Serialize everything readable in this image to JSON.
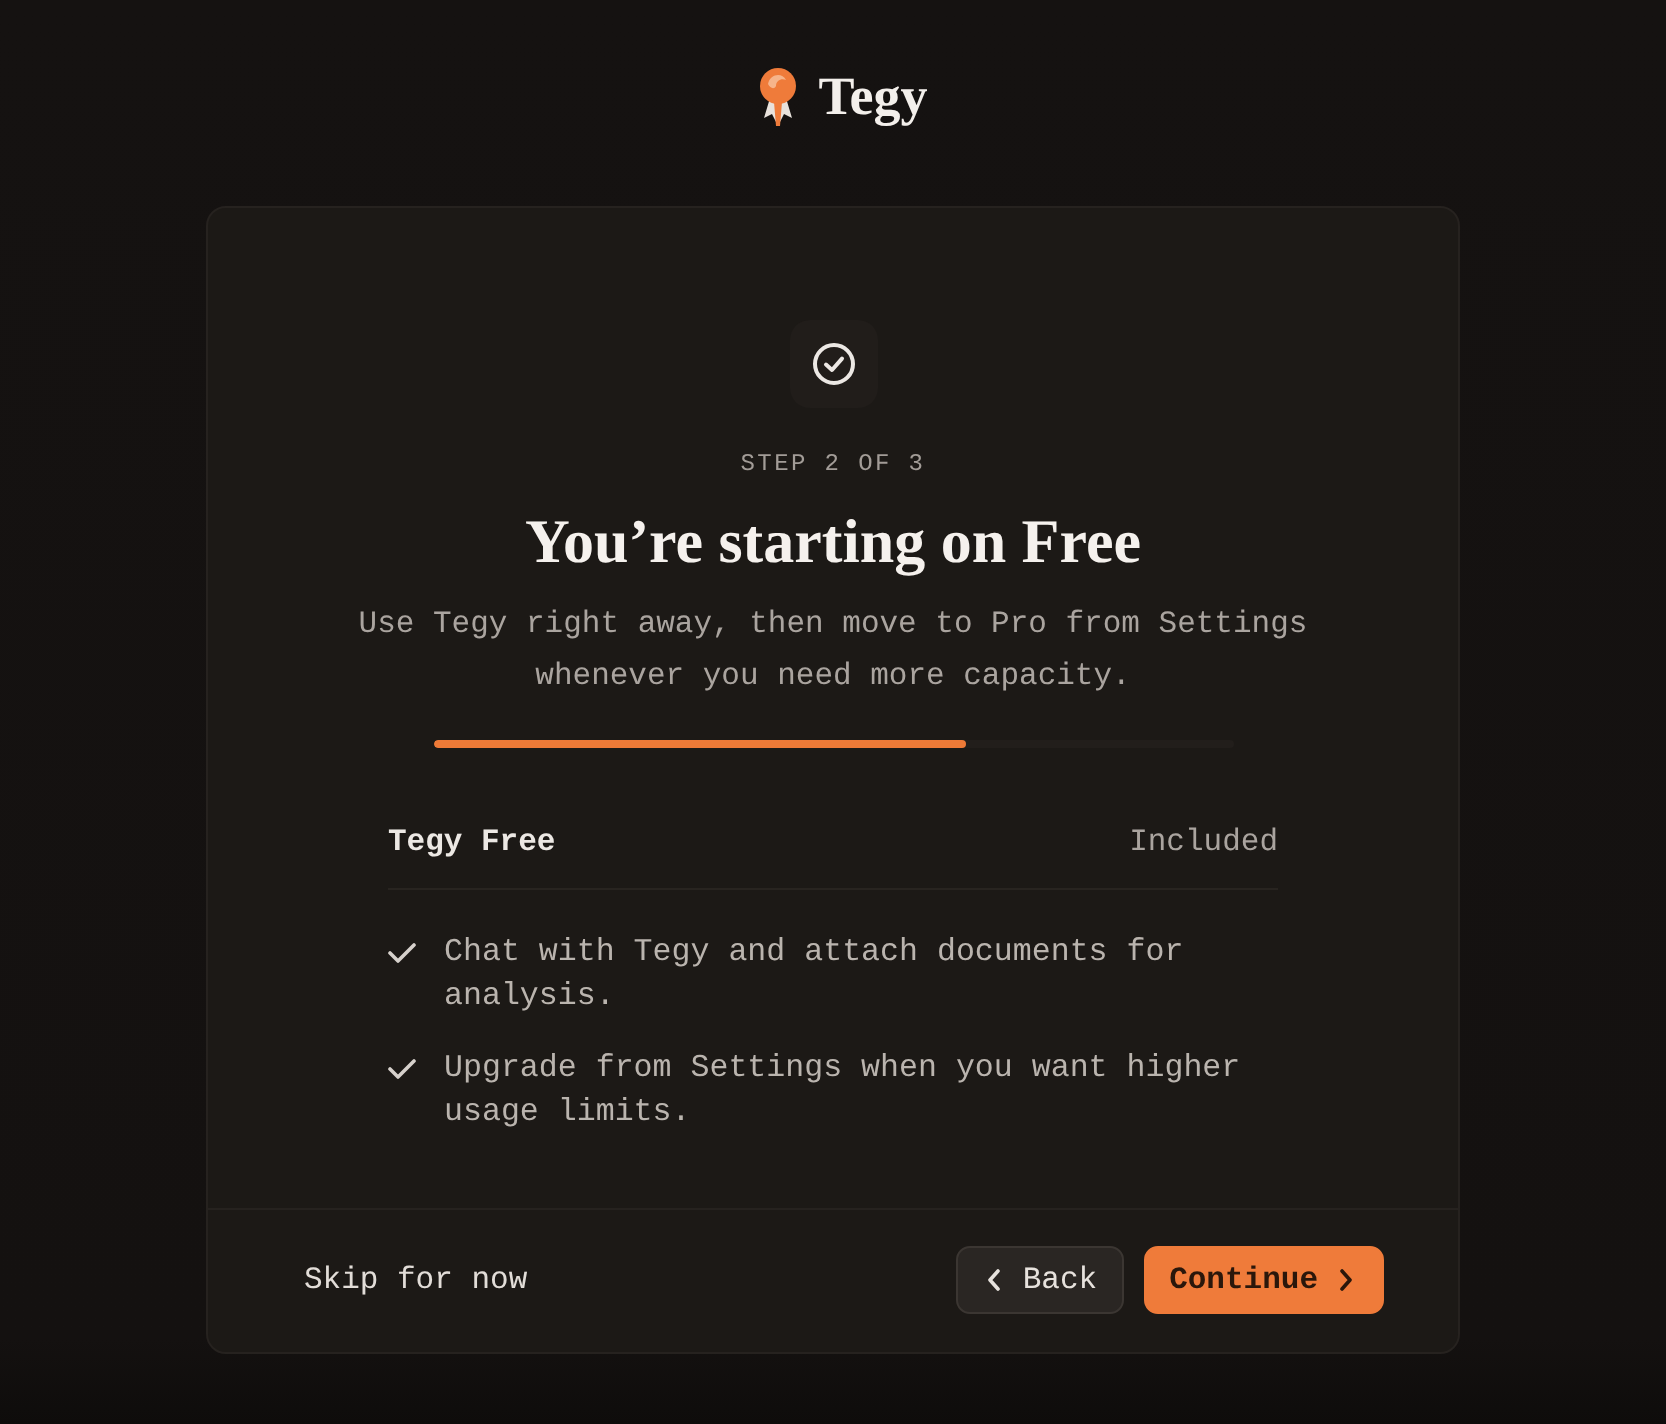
{
  "header": {
    "logo_text": "Tegy"
  },
  "step": {
    "label": "STEP 2 OF 3"
  },
  "title": "You’re starting on Free",
  "subtitle": "Use Tegy right away, then move to Pro from Settings whenever you need more capacity.",
  "progress": {
    "level": 0.667
  },
  "plan": {
    "name": "Tegy Free",
    "status": "Included"
  },
  "features": [
    {
      "text": "Chat with Tegy and attach documents for analysis."
    },
    {
      "text": "Upgrade from Settings when you want higher usage limits."
    }
  ],
  "footer": {
    "skip": "Skip for now",
    "back": "Back",
    "continue": "Continue"
  }
}
